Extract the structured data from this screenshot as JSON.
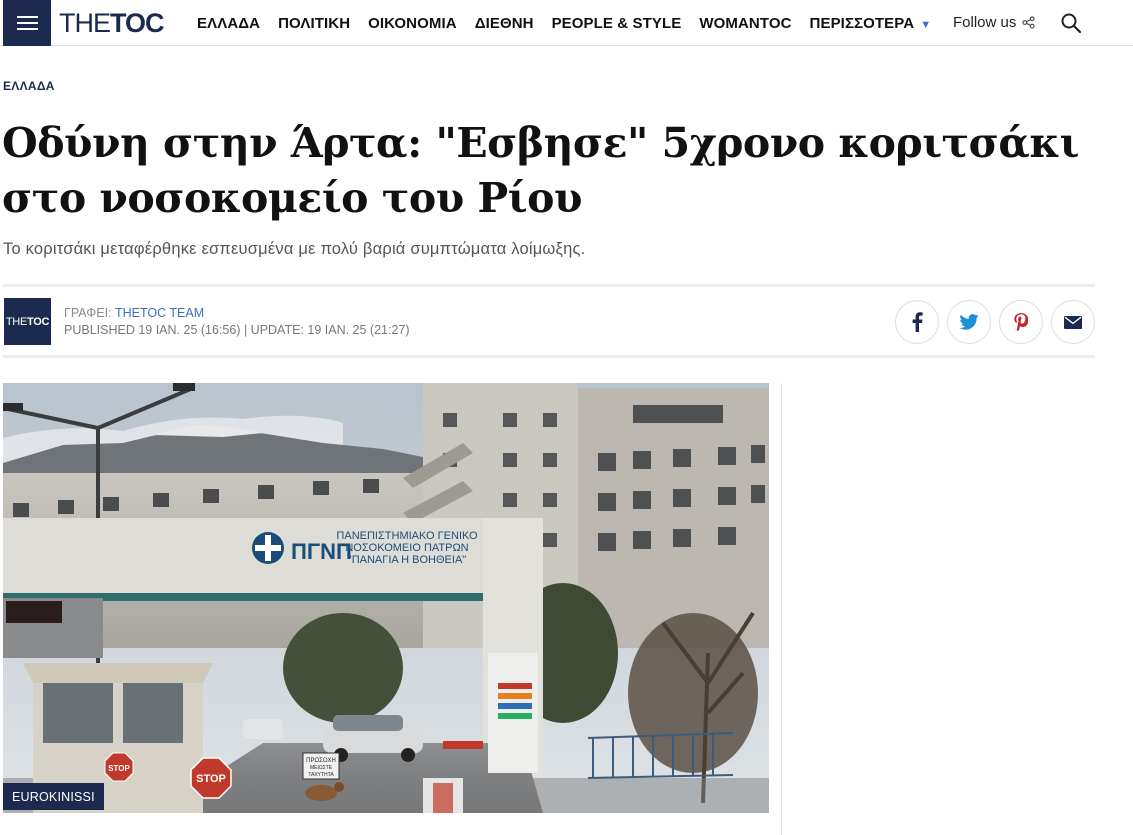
{
  "header": {
    "logo_thin": "THE",
    "logo_bold": "TOC",
    "nav": [
      "ΕΛΛΑΔΑ",
      "ΠΟΛΙΤΙΚΗ",
      "ΟΙΚΟΝΟΜΙΑ",
      "ΔΙΕΘΝΗ",
      "PEOPLE & STYLE",
      "WOMANTOC",
      "ΠΕΡΙΣΣΟΤΕΡΑ"
    ],
    "follow_label": "Follow us"
  },
  "article": {
    "category": "ΕΛΛΑΔΑ",
    "title": "Οδύνη στην Άρτα: \"Εσβησε\" 5χρονο κοριτσάκι στο νοσοκομείο του Ρίου",
    "dek": "Το κοριτσάκι μεταφέρθηκε εσπευσμένα με πολύ βαριά συμπτώματα λοίμωξης.",
    "byline_prefix": "ΓΡΑΦΕΙ: ",
    "author": "THETOC TEAM",
    "dates": "PUBLISHED 19 ΙΑΝ. 25 (16:56) | UPDATE: 19 ΙΑΝ. 25 (21:27)",
    "author_logo_thin": "THE",
    "author_logo_bold": "TOC",
    "image_credit": "EUROKINISSI"
  },
  "image_text": {
    "hospital_sign_1": "ΠΑΝΕΠΙΣΤΗΜΙΑΚΟ ΓΕΝΙΚΟ",
    "hospital_sign_2": "ΝΟΣΟΚΟΜΕΙΟ ΠΑΤΡΩΝ",
    "hospital_sign_3": "\"ΠΑΝΑΓΙΑ Η ΒΟΗΘΕΙΑ\"",
    "hospital_abbr": "ΠΓΝΠ",
    "stop_1": "STOP",
    "stop_2": "STOP",
    "caution_1": "ΠΡΟΣΟΧΗ",
    "caution_2": "ΜΕΙΩΣΤΕ",
    "caution_3": "ΤΑΧΥΤΗΤΑ"
  },
  "share_icons": [
    "facebook-icon",
    "twitter-icon",
    "pinterest-icon",
    "mail-icon"
  ],
  "colors": {
    "brand_navy": "#1b2a4e",
    "accent_blue": "#3b6fc7",
    "pinterest_red": "#c8232c"
  }
}
